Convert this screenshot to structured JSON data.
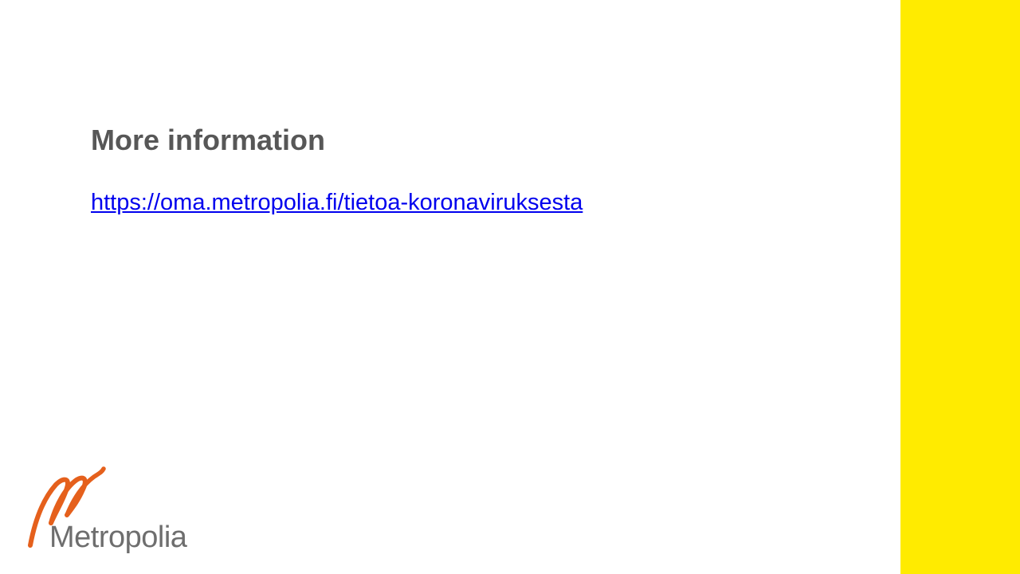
{
  "slide": {
    "title": "More information",
    "link_text": "https://oma.metropolia.fi/tietoa-koronaviruksesta"
  },
  "logo": {
    "text": "Metropolia",
    "mark_icon": "metropolia-m-swirl-icon",
    "mark_color": "#e5601c",
    "text_color": "#6e6e6e"
  },
  "colors": {
    "accent_band": "#ffeb00",
    "title": "#575757",
    "link": "#0000ee"
  }
}
